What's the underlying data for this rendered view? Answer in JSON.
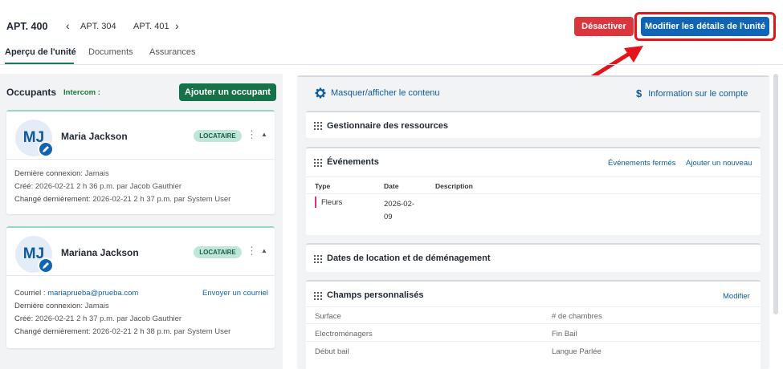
{
  "header": {
    "unit_title": "APT. 400",
    "prev_unit": "APT. 304",
    "next_unit": "APT. 401",
    "deactivate_label": "Désactiver",
    "modify_label": "Modifier les détails de l'unité"
  },
  "tabs": [
    {
      "label": "Aperçu de l'unité",
      "active": true
    },
    {
      "label": "Documents",
      "active": false
    },
    {
      "label": "Assurances",
      "active": false
    }
  ],
  "occupants": {
    "title": "Occupants",
    "intercom_label": "Intercom :",
    "add_button": "Ajouter un occupant",
    "list": [
      {
        "initials": "MJ",
        "name": "Maria Jackson",
        "badge": "LOCATAIRE",
        "last_login_label": "Dernière connexion:",
        "last_login": "Jamais",
        "created_label": "Créé:",
        "created": "2026-02-21 2 h 36 p.m. par Jacob Gauthier",
        "changed_label": "Changé dernièrement:",
        "changed": "2026-02-21 2 h 37 p.m. par System User"
      },
      {
        "initials": "MJ",
        "name": "Mariana Jackson",
        "badge": "LOCATAIRE",
        "email_label": "Courriel :",
        "email": "mariaprueba@prueba.com",
        "send_email": "Envoyer un courriel",
        "last_login_label": "Dernière connexion:",
        "last_login": "Jamais",
        "created_label": "Créé:",
        "created": "2026-02-21 2 h 37 p.m. par Jacob Gauthier",
        "changed_label": "Changé dernièrement:",
        "changed": "2026-02-21 2 h 38 p.m. par System User"
      }
    ]
  },
  "right": {
    "toggle_content": "Masquer/afficher le contenu",
    "account_info": "Information sur le compte",
    "resources_title": "Gestionnaire des ressources",
    "events": {
      "title": "Événements",
      "closed_events": "Événements fermés",
      "add_new": "Ajouter un nouveau",
      "columns": [
        "Type",
        "Date",
        "Description"
      ],
      "rows": [
        {
          "type": "Fleurs",
          "date": "2026-02-\n09",
          "description": ""
        }
      ]
    },
    "move_dates_title": "Dates de location et de déménagement",
    "custom_fields": {
      "title": "Champs personnalisés",
      "modify": "Modifier",
      "labels": [
        [
          "Surface",
          "# de chambres"
        ],
        [
          "Electroménagers",
          "Fin Bail"
        ],
        [
          "Début bail",
          "Langue Parlée"
        ]
      ]
    }
  },
  "colors": {
    "primary": "#0f64b4",
    "danger": "#d9363e",
    "success": "#177149",
    "highlight": "#e3141b"
  }
}
